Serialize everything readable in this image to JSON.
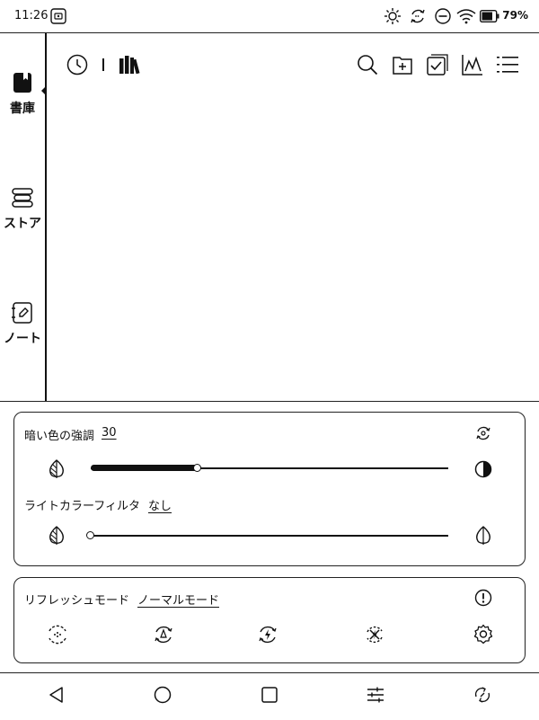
{
  "status_bar": {
    "time": "11:26",
    "battery_percent": "79%",
    "battery_level": 0.79,
    "icons": [
      "cast-icon",
      "brightness-icon",
      "sync-icon",
      "dnd-icon",
      "wifi-icon",
      "battery-icon"
    ]
  },
  "sidebar": {
    "items": [
      {
        "label": "書庫",
        "icon": "bookshelf-icon",
        "selected": true
      },
      {
        "label": "ストア",
        "icon": "store-icon",
        "selected": false
      },
      {
        "label": "ノート",
        "icon": "note-icon",
        "selected": false
      }
    ]
  },
  "toolbar": {
    "left_icons": [
      "history-icon",
      "library-icon"
    ],
    "right_icons": [
      "search-icon",
      "add-folder-icon",
      "select-icon",
      "stats-icon",
      "list-menu-icon"
    ]
  },
  "contrast_panel": {
    "dark_enhance_label": "暗い色の強調",
    "dark_enhance_value": "30",
    "dark_enhance_level": 0.3,
    "light_filter_label": "ライトカラーフィルタ",
    "light_filter_value": "なし",
    "light_filter_level": 0
  },
  "refresh_panel": {
    "label": "リフレッシュモード",
    "value": "ノーマルモード",
    "modes": [
      "hd-mode-icon",
      "balanced-mode-icon",
      "fast-mode-icon",
      "ultra-fast-mode-icon",
      "settings-icon"
    ]
  },
  "nav_bar": {
    "icons": [
      "back-icon",
      "home-icon",
      "recents-icon",
      "quick-settings-icon",
      "refresh-screen-icon"
    ]
  }
}
